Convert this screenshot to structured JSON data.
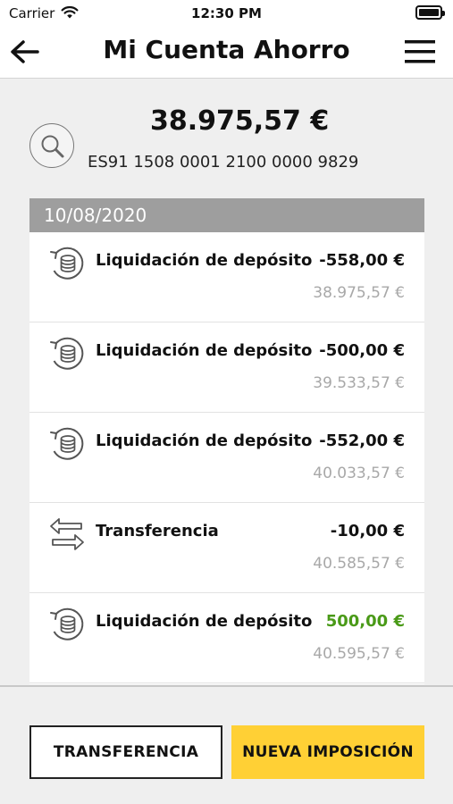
{
  "status_bar": {
    "carrier": "Carrier",
    "time": "12:30 PM"
  },
  "nav": {
    "title": "Mi Cuenta Ahorro"
  },
  "account": {
    "balance": "38.975,57 €",
    "iban": "ES91 1508 0001 2100 0000 9829"
  },
  "movements": {
    "date": "10/08/2020",
    "items": [
      {
        "icon": "coins-refund-icon",
        "label": "Liquidación de depósito",
        "amount": "-558,00 €",
        "balance": "38.975,57 €",
        "type": "negative"
      },
      {
        "icon": "coins-refund-icon",
        "label": "Liquidación de depósito",
        "amount": "-500,00 €",
        "balance": "39.533,57 €",
        "type": "negative"
      },
      {
        "icon": "coins-refund-icon",
        "label": "Liquidación de depósito",
        "amount": "-552,00 €",
        "balance": "40.033,57 €",
        "type": "negative"
      },
      {
        "icon": "transfer-arrows-icon",
        "label": "Transferencia",
        "amount": "-10,00 €",
        "balance": "40.585,57 €",
        "type": "negative"
      },
      {
        "icon": "coins-refund-icon",
        "label": "Liquidación de depósito",
        "amount": "500,00 €",
        "balance": "40.595,57 €",
        "type": "positive"
      }
    ]
  },
  "actions": {
    "transfer_label": "TRANSFERENCIA",
    "new_deposit_label": "NUEVA IMPOSICIÓN"
  },
  "colors": {
    "accent": "#ffd035",
    "positive": "#4a9a18",
    "date_header": "#9e9e9e",
    "muted_text": "#a8a8a8"
  }
}
